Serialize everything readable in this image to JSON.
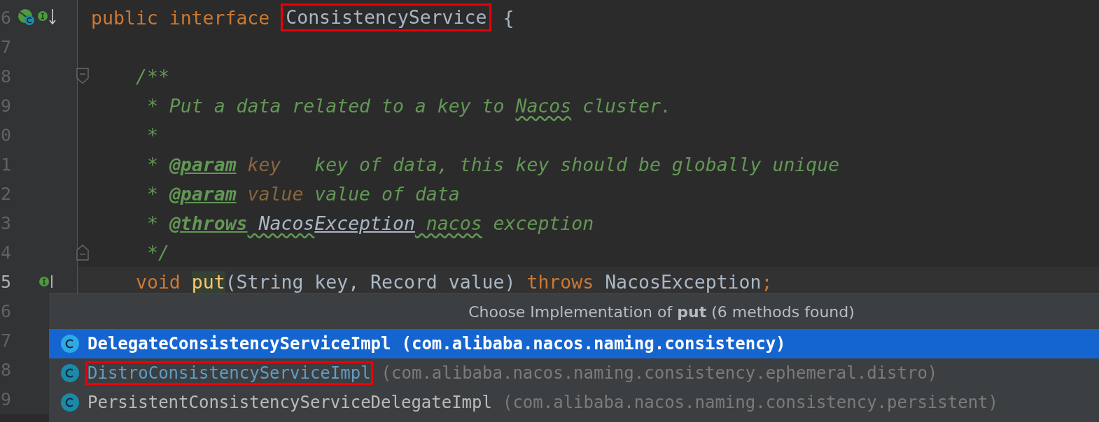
{
  "editor": {
    "lines": [
      {
        "number": "6",
        "implemented_marker": true,
        "segments": [
          {
            "kind": "keyword",
            "text": "public interface "
          },
          {
            "kind": "ident",
            "text": "ConsistencyService",
            "boxed": true
          },
          {
            "kind": "plain",
            "text": " {"
          }
        ],
        "children": [
          {
            "number": "7"
          },
          {
            "number": "8",
            "fold_start": true,
            "segments": [
              {
                "kind": "comment",
                "text": "/**"
              }
            ]
          },
          {
            "number": "9",
            "segments": [
              {
                "kind": "comment",
                "text": " * Put a data related to a key to "
              },
              {
                "kind": "comment",
                "text": "Nacos",
                "typo": true
              },
              {
                "kind": "comment",
                "text": " cluster."
              }
            ]
          },
          {
            "number": "0",
            "segments": [
              {
                "kind": "comment",
                "text": " *"
              }
            ]
          },
          {
            "number": "1",
            "segments": [
              {
                "kind": "comment",
                "text": " * "
              },
              {
                "kind": "tag",
                "text": "@param"
              },
              {
                "kind": "param",
                "text": " key"
              },
              {
                "kind": "comment",
                "text": "   key of data, this key should be globally unique"
              }
            ]
          },
          {
            "number": "2",
            "segments": [
              {
                "kind": "comment",
                "text": " * "
              },
              {
                "kind": "tag",
                "text": "@param"
              },
              {
                "kind": "param",
                "text": " value"
              },
              {
                "kind": "comment",
                "text": " value of data"
              }
            ]
          },
          {
            "number": "3",
            "segments": [
              {
                "kind": "comment",
                "text": " * "
              },
              {
                "kind": "tag",
                "text": "@throws"
              },
              {
                "kind": "ref",
                "text": " Nacos",
                "typo": true
              },
              {
                "kind": "ref",
                "text": "Exception"
              },
              {
                "kind": "comment",
                "text": " nacos",
                "typo": true
              },
              {
                "kind": "comment",
                "text": " exception"
              }
            ]
          },
          {
            "number": "4",
            "fold_end": true,
            "segments": [
              {
                "kind": "comment",
                "text": " */"
              }
            ]
          },
          {
            "number": "5",
            "current": true,
            "implementing_marker": true,
            "segments": [
              {
                "kind": "keyword",
                "text": "void "
              },
              {
                "kind": "method",
                "text": "put"
              },
              {
                "kind": "ident",
                "text": "(String key, Record value) "
              },
              {
                "kind": "keyword",
                "text": "throws"
              },
              {
                "kind": "ident",
                "text": " NacosException"
              },
              {
                "kind": "keyword",
                "text": ";"
              }
            ]
          }
        ]
      },
      {
        "number": "6"
      },
      {
        "number": "7"
      },
      {
        "number": "8"
      },
      {
        "number": "9"
      }
    ]
  },
  "popup": {
    "title": "Choose Implementation of **put** (6 methods found)",
    "items": [
      {
        "name": "DelegateConsistencyServiceImpl",
        "package": "(com.alibaba.nacos.naming.consistency)",
        "selected": true,
        "boxed": false
      },
      {
        "name": "DistroConsistencyServiceImpl",
        "package": "(com.alibaba.nacos.naming.consistency.ephemeral.distro)",
        "selected": false,
        "color": "#5d9ec7",
        "boxed": true
      },
      {
        "name": "PersistentConsistencyServiceDelegateImpl",
        "package": "(com.alibaba.nacos.naming.consistency.persistent)",
        "selected": false,
        "color": "#bbbbbb",
        "boxed": false
      }
    ]
  }
}
